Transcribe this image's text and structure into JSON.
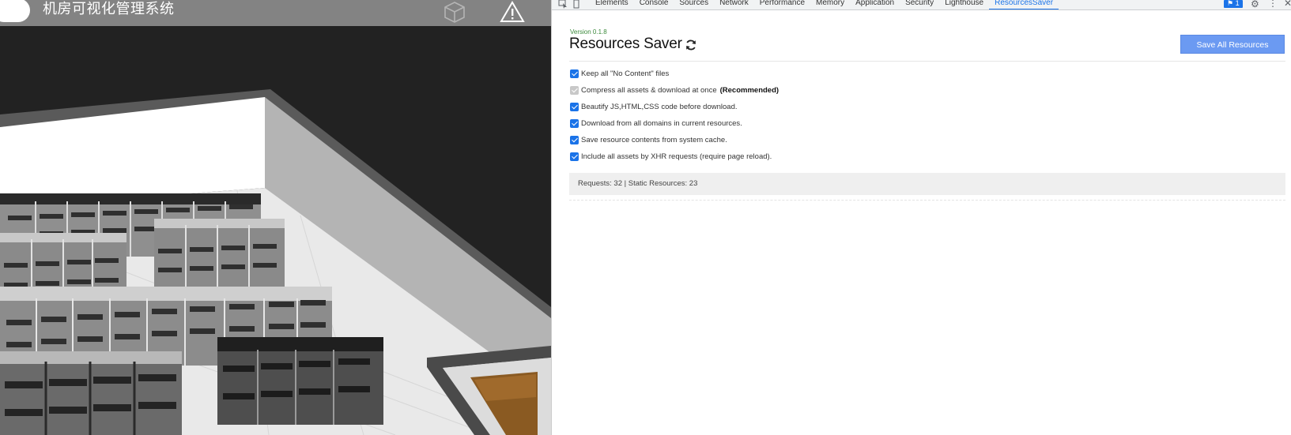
{
  "viewport": {
    "title": "机房可视化管理系统",
    "cube_icon": "cube-outline-icon",
    "warning_icon": "warning-triangle-icon"
  },
  "devtools": {
    "tabs": [
      {
        "label": "Elements",
        "active": false
      },
      {
        "label": "Console",
        "active": false
      },
      {
        "label": "Sources",
        "active": false
      },
      {
        "label": "Network",
        "active": false
      },
      {
        "label": "Performance",
        "active": false
      },
      {
        "label": "Memory",
        "active": false
      },
      {
        "label": "Application",
        "active": false
      },
      {
        "label": "Security",
        "active": false
      },
      {
        "label": "Lighthouse",
        "active": false
      },
      {
        "label": "ResourcesSaver",
        "active": true
      }
    ],
    "issues_badge": "1",
    "accent_color": "#1a73e8"
  },
  "resources_saver": {
    "version": "Version 0.1.8",
    "title": "Resources Saver",
    "save_button": "Save All Resources",
    "options": [
      {
        "label": "Keep all \"No Content\" files",
        "checked": true,
        "disabled": false,
        "note": ""
      },
      {
        "label": "Compress all assets & download at once",
        "checked": true,
        "disabled": true,
        "note": "(Recommended)"
      },
      {
        "label": "Beautify JS,HTML,CSS code before download.",
        "checked": true,
        "disabled": false,
        "note": ""
      },
      {
        "label": "Download from all domains in current resources.",
        "checked": true,
        "disabled": false,
        "note": ""
      },
      {
        "label": "Save resource contents from system cache.",
        "checked": true,
        "disabled": false,
        "note": ""
      },
      {
        "label": "Include all assets by XHR requests (require page reload).",
        "checked": true,
        "disabled": false,
        "note": ""
      }
    ],
    "stats": "Requests: 32 | Static Resources: 23",
    "button_color": "#6b9af2"
  }
}
